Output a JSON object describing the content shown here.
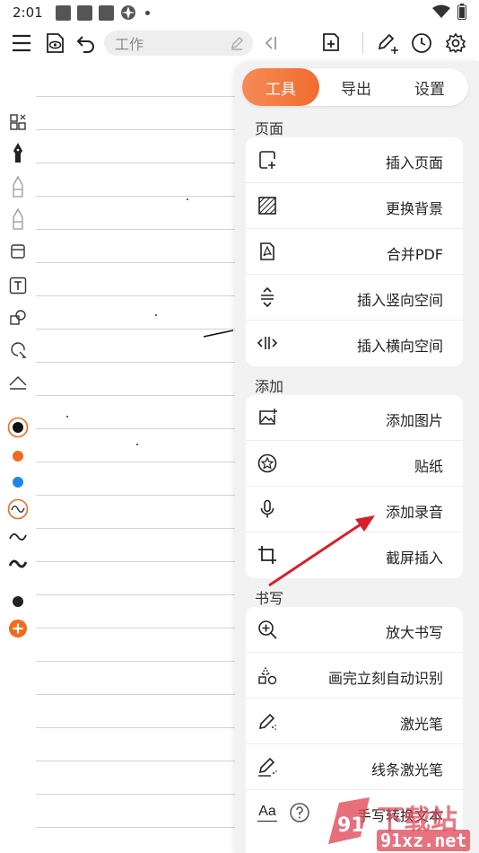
{
  "status_bar": {
    "time": "2:01"
  },
  "toolbar": {
    "title_placeholder": "工作"
  },
  "tabs": [
    {
      "label": "工具",
      "active": true
    },
    {
      "label": "导出",
      "active": false
    },
    {
      "label": "设置",
      "active": false
    }
  ],
  "sections": [
    {
      "title": "页面",
      "items": [
        {
          "label": "插入页面",
          "icon": "insert-page-icon"
        },
        {
          "label": "更换背景",
          "icon": "change-background-icon"
        },
        {
          "label": "合并PDF",
          "icon": "pdf-icon"
        },
        {
          "label": "插入竖向空间",
          "icon": "vertical-space-icon"
        },
        {
          "label": "插入横向空间",
          "icon": "horizontal-space-icon"
        }
      ]
    },
    {
      "title": "添加",
      "items": [
        {
          "label": "添加图片",
          "icon": "image-icon"
        },
        {
          "label": "贴纸",
          "icon": "sticker-icon"
        },
        {
          "label": "添加录音",
          "icon": "microphone-icon"
        },
        {
          "label": "截屏插入",
          "icon": "crop-icon"
        }
      ]
    },
    {
      "title": "书写",
      "items": [
        {
          "label": "放大书写",
          "icon": "zoom-in-icon"
        },
        {
          "label": "画完立刻自动识别",
          "icon": "shape-recognize-icon"
        },
        {
          "label": "激光笔",
          "icon": "laser-pen-icon"
        },
        {
          "label": "线条激光笔",
          "icon": "line-laser-pen-icon"
        },
        {
          "label": "手写转换文本",
          "icon": "text-convert-icon",
          "prefix": "Aa"
        }
      ]
    }
  ],
  "watermark": {
    "brand": "下载站",
    "url": "91xz.net",
    "glyph": "91"
  },
  "colors": {
    "accent": "#f26b2f",
    "orange": "#f26b1d",
    "blue": "#1e88e5",
    "black": "#111111",
    "arrow": "#d8202a"
  }
}
